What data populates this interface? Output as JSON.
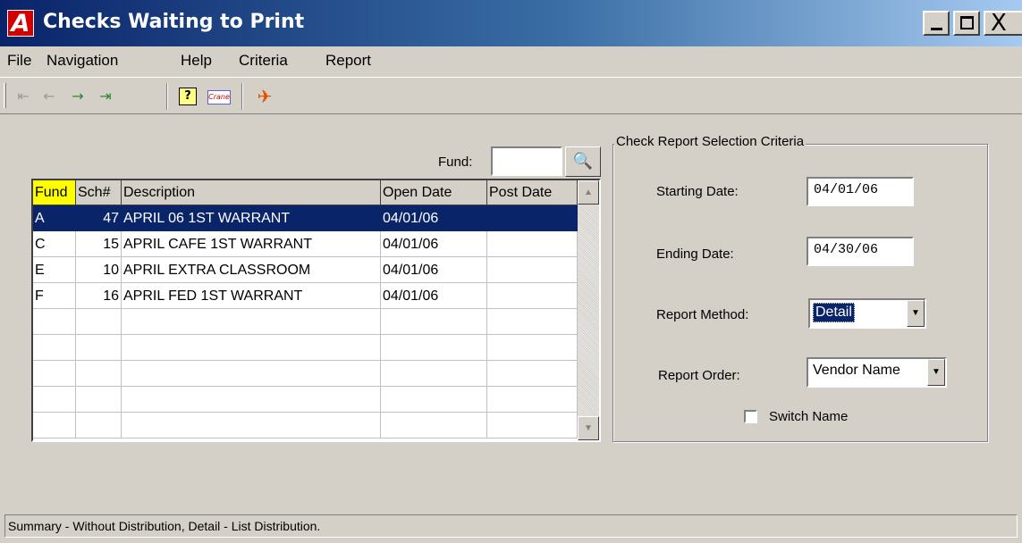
{
  "window": {
    "title": "Checks Waiting to Print",
    "icon_letter": "A",
    "controls": {
      "minimize": "_",
      "maximize": "□",
      "close": "X"
    }
  },
  "menu": [
    "File",
    "Navigation",
    "Help",
    "Criteria",
    "Report"
  ],
  "toolbar": {
    "icons": [
      "first-record-icon",
      "previous-record-icon",
      "next-record-icon",
      "last-record-icon",
      "help-icon",
      "logo-icon",
      "exit-icon"
    ],
    "logo_text": "Crane"
  },
  "fund_filter": {
    "label": "Fund:",
    "value": ""
  },
  "grid": {
    "columns": [
      "Fund",
      "Sch#",
      "Description",
      "Open Date",
      "Post Date"
    ],
    "rows": [
      {
        "fund": "A",
        "sch": "47",
        "description": "APRIL 06 1ST WARRANT",
        "open_date": "04/01/06",
        "post_date": ""
      },
      {
        "fund": "C",
        "sch": "15",
        "description": "APRIL CAFE 1ST WARRANT",
        "open_date": "04/01/06",
        "post_date": ""
      },
      {
        "fund": "E",
        "sch": "10",
        "description": "APRIL EXTRA CLASSROOM",
        "open_date": "04/01/06",
        "post_date": ""
      },
      {
        "fund": "F",
        "sch": "16",
        "description": "APRIL FED 1ST WARRANT",
        "open_date": "04/01/06",
        "post_date": ""
      }
    ],
    "selected_row": 0,
    "empty_rows": 5
  },
  "criteria": {
    "title": "Check Report Selection Criteria",
    "starting_date_label": "Starting Date:",
    "starting_date": "04/01/06",
    "ending_date_label": "Ending Date:",
    "ending_date": "04/30/06",
    "report_method_label": "Report Method:",
    "report_method": "Detail",
    "report_order_label": "Report Order:",
    "report_order": "Vendor Name",
    "switch_name_label": "Switch Name",
    "switch_name_checked": false
  },
  "status": "Summary - Without Distribution, Detail - List Distribution.",
  "colors": {
    "title_start": "#0a246a",
    "title_end": "#a6caf0",
    "selection": "#0a246a",
    "active_header": "#ffff00"
  }
}
